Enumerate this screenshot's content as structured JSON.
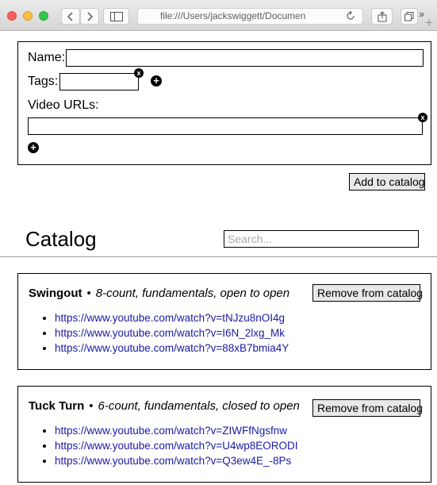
{
  "browser": {
    "address": "file:///Users/jackswiggett/Documen"
  },
  "form": {
    "name_label": "Name:",
    "name_value": "",
    "tags_label": "Tags:",
    "tags_value": "",
    "video_urls_label": "Video URLs:",
    "video_url_value": "",
    "remove_glyph": "x",
    "add_glyph": "+",
    "add_to_catalog": "Add to catalog"
  },
  "catalog": {
    "title": "Catalog",
    "search_placeholder": "Search...",
    "remove_label": "Remove from catalog",
    "separator": "•",
    "items": [
      {
        "name": "Swingout",
        "tags": "8-count, fundamentals, open to open",
        "urls": [
          "https://www.youtube.com/watch?v=tNJzu8nOI4g",
          "https://www.youtube.com/watch?v=I6N_2lxg_Mk",
          "https://www.youtube.com/watch?v=88xB7bmia4Y"
        ]
      },
      {
        "name": "Tuck Turn",
        "tags": "6-count, fundamentals, closed to open",
        "urls": [
          "https://www.youtube.com/watch?v=ZIWFfNgsfnw",
          "https://www.youtube.com/watch?v=U4wp8EORODI",
          "https://www.youtube.com/watch?v=Q3ew4E_-8Ps"
        ]
      }
    ]
  }
}
